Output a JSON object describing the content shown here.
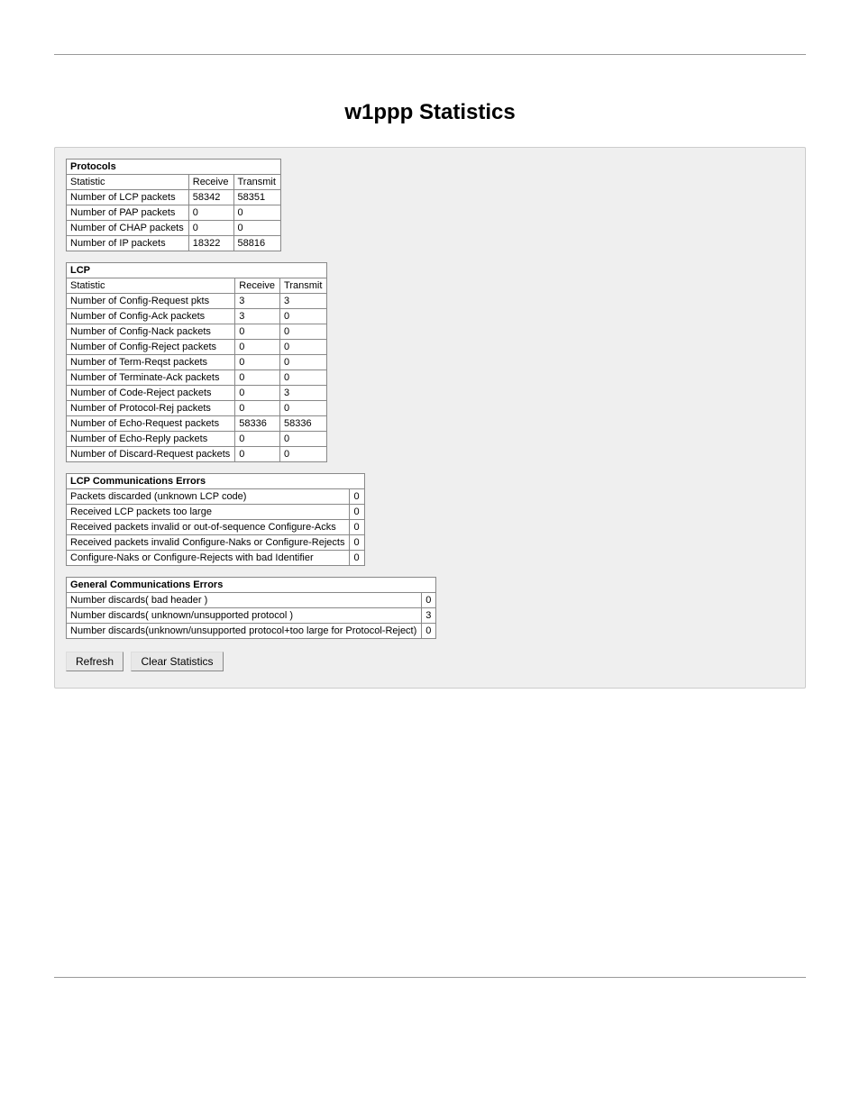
{
  "title": "w1ppp Statistics",
  "protocols": {
    "heading": "Protocols",
    "col_stat": "Statistic",
    "col_rx": "Receive",
    "col_tx": "Transmit",
    "rows": [
      {
        "label": "Number of LCP packets",
        "rx": "58342",
        "tx": "58351"
      },
      {
        "label": "Number of PAP packets",
        "rx": "0",
        "tx": "0"
      },
      {
        "label": "Number of CHAP packets",
        "rx": "0",
        "tx": "0"
      },
      {
        "label": "Number of IP packets",
        "rx": "18322",
        "tx": "58816"
      }
    ]
  },
  "lcp": {
    "heading": "LCP",
    "col_stat": "Statistic",
    "col_rx": "Receive",
    "col_tx": "Transmit",
    "rows": [
      {
        "label": "Number of Config-Request pkts",
        "rx": "3",
        "tx": "3"
      },
      {
        "label": "Number of Config-Ack packets",
        "rx": "3",
        "tx": "0"
      },
      {
        "label": "Number of Config-Nack packets",
        "rx": "0",
        "tx": "0"
      },
      {
        "label": "Number of Config-Reject packets",
        "rx": "0",
        "tx": "0"
      },
      {
        "label": "Number of Term-Reqst packets",
        "rx": "0",
        "tx": "0"
      },
      {
        "label": "Number of Terminate-Ack packets",
        "rx": "0",
        "tx": "0"
      },
      {
        "label": "Number of Code-Reject packets",
        "rx": "0",
        "tx": "3"
      },
      {
        "label": "Number of Protocol-Rej packets",
        "rx": "0",
        "tx": "0"
      },
      {
        "label": "Number of Echo-Request packets",
        "rx": "58336",
        "tx": "58336"
      },
      {
        "label": "Number of Echo-Reply packets",
        "rx": "0",
        "tx": "0"
      },
      {
        "label": "Number of Discard-Request packets",
        "rx": "0",
        "tx": "0"
      }
    ]
  },
  "lcp_errors": {
    "heading": "LCP Communications Errors",
    "rows": [
      {
        "label": "Packets discarded (unknown LCP code)",
        "val": "0"
      },
      {
        "label": "Received LCP packets too large",
        "val": "0"
      },
      {
        "label": "Received packets invalid or out-of-sequence Configure-Acks",
        "val": "0"
      },
      {
        "label": "Received packets invalid Configure-Naks or Configure-Rejects",
        "val": "0"
      },
      {
        "label": "Configure-Naks or Configure-Rejects with bad Identifier",
        "val": "0"
      }
    ]
  },
  "gen_errors": {
    "heading": "General Communications Errors",
    "rows": [
      {
        "label": "Number discards( bad header )",
        "val": "0"
      },
      {
        "label": "Number discards( unknown/unsupported protocol )",
        "val": "3"
      },
      {
        "label": "Number discards(unknown/unsupported protocol+too large for Protocol-Reject)",
        "val": "0"
      }
    ]
  },
  "buttons": {
    "refresh": "Refresh",
    "clear": "Clear Statistics"
  }
}
